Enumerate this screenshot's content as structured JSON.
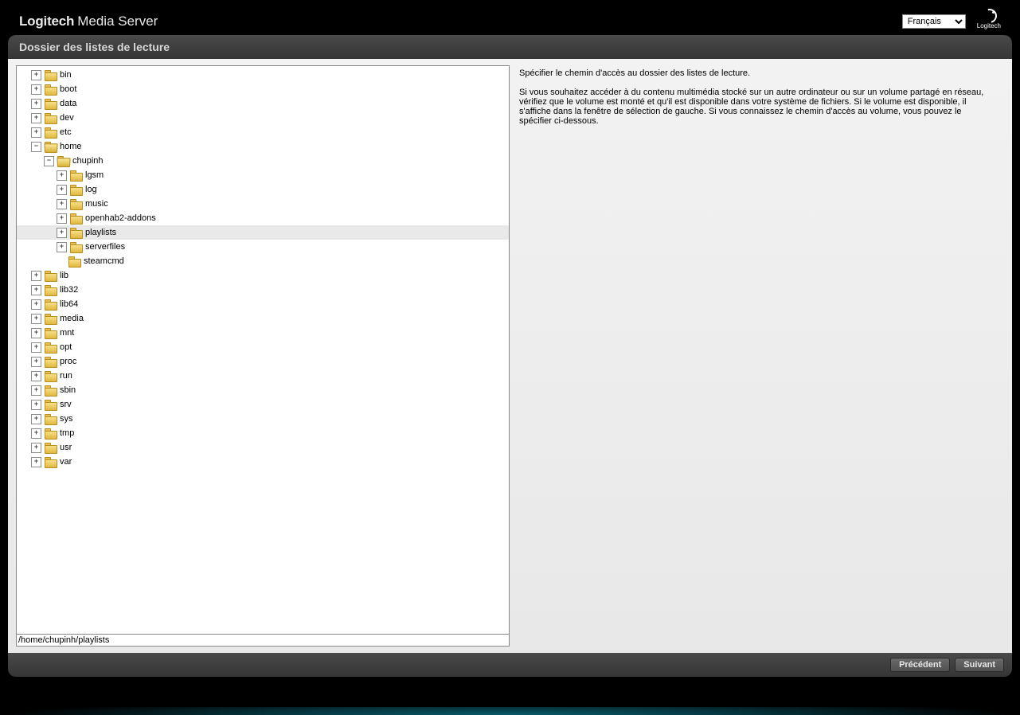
{
  "brand": {
    "bold": "Logitech",
    "light": "Media Server",
    "logo_text": "Logitech"
  },
  "language": {
    "selected": "Français"
  },
  "page_title": "Dossier des listes de lecture",
  "help": {
    "line1": "Spécifier le chemin d'accès au dossier des listes de lecture.",
    "line2": "Si vous souhaitez accéder à du contenu multimédia stocké sur un autre ordinateur ou sur un volume partagé en réseau, vérifiez que le volume est monté et qu'il est disponible dans votre système de fichiers. Si le volume est disponible, il s'affiche dans la fenêtre de sélection de gauche. Si vous connaissez le chemin d'accès au volume, vous pouvez le spécifier ci-dessous."
  },
  "path_value": "/home/chupinh/playlists",
  "buttons": {
    "prev": "Précédent",
    "next": "Suivant"
  },
  "tree": [
    {
      "depth": 0,
      "toggle": "+",
      "open": false,
      "label": "bin",
      "selected": false
    },
    {
      "depth": 0,
      "toggle": "+",
      "open": false,
      "label": "boot",
      "selected": false
    },
    {
      "depth": 0,
      "toggle": "+",
      "open": false,
      "label": "data",
      "selected": false
    },
    {
      "depth": 0,
      "toggle": "+",
      "open": false,
      "label": "dev",
      "selected": false
    },
    {
      "depth": 0,
      "toggle": "+",
      "open": false,
      "label": "etc",
      "selected": false
    },
    {
      "depth": 0,
      "toggle": "-",
      "open": true,
      "label": "home",
      "selected": false
    },
    {
      "depth": 1,
      "toggle": "-",
      "open": true,
      "label": "chupinh",
      "selected": false
    },
    {
      "depth": 2,
      "toggle": "+",
      "open": false,
      "label": "lgsm",
      "selected": false
    },
    {
      "depth": 2,
      "toggle": "+",
      "open": false,
      "label": "log",
      "selected": false
    },
    {
      "depth": 2,
      "toggle": "+",
      "open": false,
      "label": "music",
      "selected": false
    },
    {
      "depth": 2,
      "toggle": "+",
      "open": false,
      "label": "openhab2-addons",
      "selected": false
    },
    {
      "depth": 2,
      "toggle": "+",
      "open": false,
      "label": "playlists",
      "selected": true
    },
    {
      "depth": 2,
      "toggle": "+",
      "open": false,
      "label": "serverfiles",
      "selected": false
    },
    {
      "depth": 2,
      "toggle": "",
      "open": false,
      "label": "steamcmd",
      "selected": false
    },
    {
      "depth": 0,
      "toggle": "+",
      "open": false,
      "label": "lib",
      "selected": false
    },
    {
      "depth": 0,
      "toggle": "+",
      "open": false,
      "label": "lib32",
      "selected": false
    },
    {
      "depth": 0,
      "toggle": "+",
      "open": false,
      "label": "lib64",
      "selected": false
    },
    {
      "depth": 0,
      "toggle": "+",
      "open": false,
      "label": "media",
      "selected": false
    },
    {
      "depth": 0,
      "toggle": "+",
      "open": false,
      "label": "mnt",
      "selected": false
    },
    {
      "depth": 0,
      "toggle": "+",
      "open": false,
      "label": "opt",
      "selected": false
    },
    {
      "depth": 0,
      "toggle": "+",
      "open": false,
      "label": "proc",
      "selected": false
    },
    {
      "depth": 0,
      "toggle": "+",
      "open": false,
      "label": "run",
      "selected": false
    },
    {
      "depth": 0,
      "toggle": "+",
      "open": false,
      "label": "sbin",
      "selected": false
    },
    {
      "depth": 0,
      "toggle": "+",
      "open": false,
      "label": "srv",
      "selected": false
    },
    {
      "depth": 0,
      "toggle": "+",
      "open": false,
      "label": "sys",
      "selected": false
    },
    {
      "depth": 0,
      "toggle": "+",
      "open": false,
      "label": "tmp",
      "selected": false
    },
    {
      "depth": 0,
      "toggle": "+",
      "open": false,
      "label": "usr",
      "selected": false
    },
    {
      "depth": 0,
      "toggle": "+",
      "open": false,
      "label": "var",
      "selected": false
    }
  ]
}
